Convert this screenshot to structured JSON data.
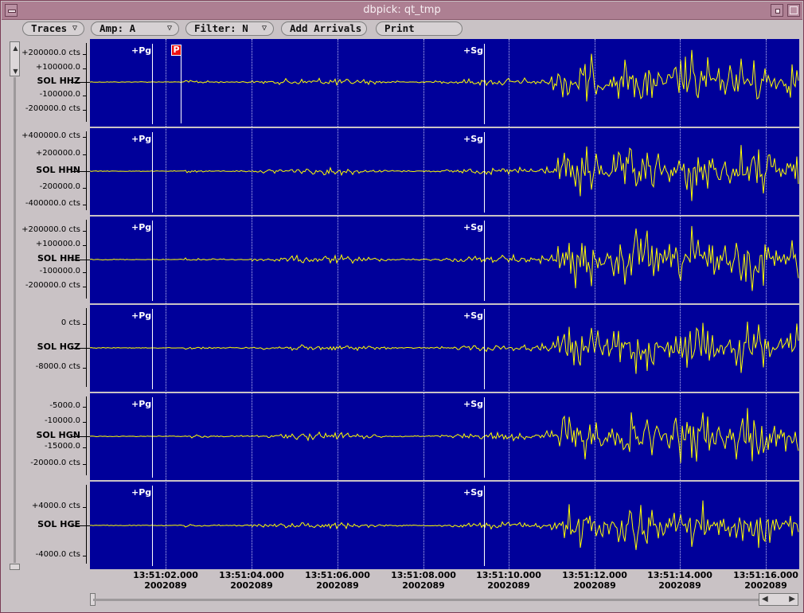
{
  "window": {
    "title": "dbpick: qt_tmp"
  },
  "toolbar": {
    "traces": "Traces",
    "amp": "Amp: A",
    "filter": "Filter: N",
    "add_arrivals": "Add Arrivals",
    "print": "Print",
    "dropdown_glyph": "▽"
  },
  "phases": {
    "pg": "+Pg",
    "sg": "+Sg",
    "pick": "P"
  },
  "channels": [
    {
      "name": "SOL HHZ",
      "ticks": [
        "+200000.0 cts",
        "+100000.0",
        "-100000.0",
        "-200000.0 cts"
      ]
    },
    {
      "name": "SOL HHN",
      "ticks": [
        "+400000.0 cts",
        "+200000.0",
        "-200000.0",
        "-400000.0 cts"
      ]
    },
    {
      "name": "SOL HHE",
      "ticks": [
        "+200000.0 cts",
        "+100000.0",
        "-100000.0",
        "-200000.0 cts"
      ]
    },
    {
      "name": "SOL HGZ",
      "ticks": [
        "0 cts",
        "-8000.0 cts"
      ]
    },
    {
      "name": "SOL HGN",
      "ticks": [
        "-5000.0",
        "-10000.0",
        "-15000.0",
        "-20000.0 cts"
      ]
    },
    {
      "name": "SOL HGE",
      "ticks": [
        "+4000.0 cts",
        "-4000.0 cts"
      ]
    }
  ],
  "time_axis": [
    {
      "time": "13:51:02.000",
      "date": "2002089"
    },
    {
      "time": "13:51:04.000",
      "date": "2002089"
    },
    {
      "time": "13:51:06.000",
      "date": "2002089"
    },
    {
      "time": "13:51:08.000",
      "date": "2002089"
    },
    {
      "time": "13:51:10.000",
      "date": "2002089"
    },
    {
      "time": "13:51:12.000",
      "date": "2002089"
    },
    {
      "time": "13:51:14.000",
      "date": "2002089"
    },
    {
      "time": "13:51:16.000",
      "date": "2002089"
    }
  ],
  "colors": {
    "background": "#00009a",
    "trace": "#ffff00",
    "pick": "#ee1111"
  },
  "icons": [
    "window-menu-icon",
    "iconify-icon",
    "maximize-icon",
    "dropdown-arrow-icon",
    "scroll-up-icon",
    "scroll-down-icon",
    "scroll-left-icon",
    "scroll-right-icon"
  ]
}
